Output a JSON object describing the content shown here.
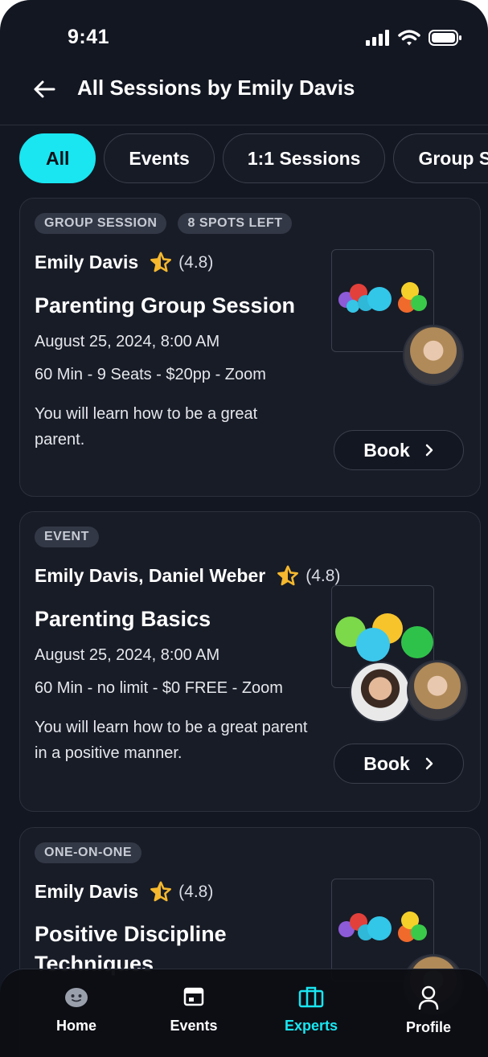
{
  "status_bar": {
    "time": "9:41"
  },
  "header": {
    "title": "All Sessions by Emily Davis"
  },
  "filters": [
    {
      "label": "All",
      "active": true
    },
    {
      "label": "Events",
      "active": false
    },
    {
      "label": "1:1 Sessions",
      "active": false
    },
    {
      "label": "Group Sessions",
      "active": false
    }
  ],
  "sessions": [
    {
      "badges": [
        "GROUP SESSION",
        "8 SPOTS LEFT"
      ],
      "host": "Emily Davis",
      "rating": "(4.8)",
      "title": "Parenting Group Session",
      "date": "August 25, 2024, 8:00 AM",
      "details": "60 Min - 9 Seats - $20pp - Zoom",
      "description": "You will learn how to be a great parent.",
      "book_label": "Book"
    },
    {
      "badges": [
        "EVENT"
      ],
      "host": "Emily Davis, Daniel Weber",
      "rating": "(4.8)",
      "title": "Parenting Basics",
      "date": "August 25, 2024, 8:00 AM",
      "details": "60 Min - no limit - $0 FREE - Zoom",
      "description": "You will learn how to be a great parent in a positive manner.",
      "book_label": "Book"
    },
    {
      "badges": [
        "ONE-ON-ONE"
      ],
      "host": "Emily Davis",
      "rating": "(4.8)",
      "title": "Positive Discipline Techniques"
    }
  ],
  "bottom_nav": [
    {
      "label": "Home",
      "icon": "home-face-icon",
      "active": false
    },
    {
      "label": "Events",
      "icon": "calendar-icon",
      "active": false
    },
    {
      "label": "Experts",
      "icon": "briefcase-icon",
      "active": true
    },
    {
      "label": "Profile",
      "icon": "person-icon",
      "active": false
    }
  ],
  "colors": {
    "accent": "#19e6f1",
    "background": "#131722",
    "card": "#181c27",
    "star": "#f5b82e"
  }
}
